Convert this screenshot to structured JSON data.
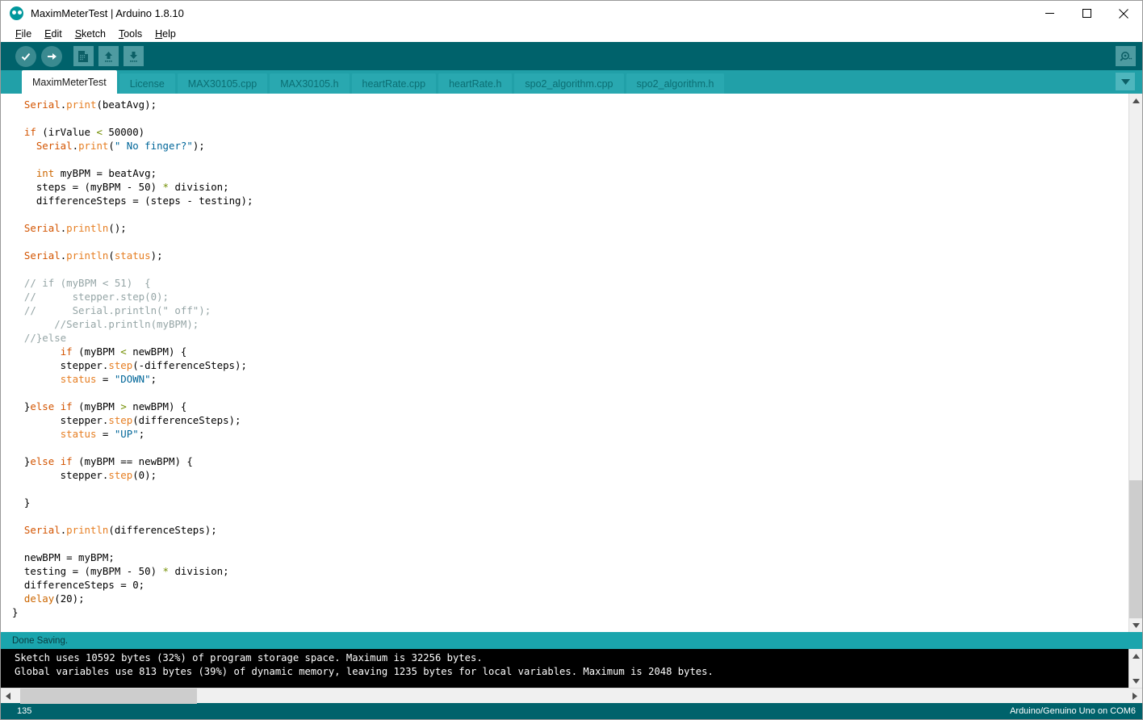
{
  "window": {
    "title": "MaximMeterTest | Arduino 1.8.10",
    "logo_icon": "arduino-logo-icon",
    "minimize_label": "Minimize",
    "maximize_label": "Maximize",
    "close_label": "Close"
  },
  "menubar": {
    "items": [
      {
        "label": "File",
        "mnemonic": "F"
      },
      {
        "label": "Edit",
        "mnemonic": "E"
      },
      {
        "label": "Sketch",
        "mnemonic": "S"
      },
      {
        "label": "Tools",
        "mnemonic": "T"
      },
      {
        "label": "Help",
        "mnemonic": "H"
      }
    ]
  },
  "toolbar": {
    "buttons": [
      {
        "name": "verify-button",
        "icon": "checkmark-icon",
        "tooltip": "Verify"
      },
      {
        "name": "upload-button",
        "icon": "arrow-right-icon",
        "tooltip": "Upload"
      },
      {
        "name": "new-button",
        "icon": "new-document-icon",
        "tooltip": "New"
      },
      {
        "name": "open-button",
        "icon": "arrow-up-icon",
        "tooltip": "Open"
      },
      {
        "name": "save-button",
        "icon": "arrow-down-icon",
        "tooltip": "Save"
      }
    ],
    "serial_monitor": {
      "icon": "magnifier-icon",
      "tooltip": "Serial Monitor"
    }
  },
  "tabs": {
    "items": [
      {
        "label": "MaximMeterTest",
        "active": true
      },
      {
        "label": "License",
        "active": false
      },
      {
        "label": "MAX30105.cpp",
        "active": false
      },
      {
        "label": "MAX30105.h",
        "active": false
      },
      {
        "label": "heartRate.cpp",
        "active": false
      },
      {
        "label": "heartRate.h",
        "active": false
      },
      {
        "label": "spo2_algorithm.cpp",
        "active": false
      },
      {
        "label": "spo2_algorithm.h",
        "active": false
      }
    ],
    "dropdown_icon": "chevron-down-icon"
  },
  "editor": {
    "lines": [
      [
        {
          "t": "  ",
          "c": ""
        },
        {
          "t": "Serial",
          "c": "kw1"
        },
        {
          "t": ".",
          "c": ""
        },
        {
          "t": "print",
          "c": "kw2"
        },
        {
          "t": "(beatAvg);",
          "c": ""
        }
      ],
      [],
      [
        {
          "t": "  ",
          "c": ""
        },
        {
          "t": "if",
          "c": "kw1"
        },
        {
          "t": " (irValue ",
          "c": ""
        },
        {
          "t": "<",
          "c": "op"
        },
        {
          "t": " 50000)",
          "c": ""
        }
      ],
      [
        {
          "t": "    ",
          "c": ""
        },
        {
          "t": "Serial",
          "c": "kw1"
        },
        {
          "t": ".",
          "c": ""
        },
        {
          "t": "print",
          "c": "kw2"
        },
        {
          "t": "(",
          "c": ""
        },
        {
          "t": "\" No finger?\"",
          "c": "str"
        },
        {
          "t": ");",
          "c": ""
        }
      ],
      [],
      [
        {
          "t": "    ",
          "c": ""
        },
        {
          "t": "int",
          "c": "kw3"
        },
        {
          "t": " myBPM = beatAvg;",
          "c": ""
        }
      ],
      [
        {
          "t": "    steps = (myBPM ",
          "c": ""
        },
        {
          "t": "-",
          "c": ""
        },
        {
          "t": " 50) ",
          "c": ""
        },
        {
          "t": "*",
          "c": "op"
        },
        {
          "t": " division;",
          "c": ""
        }
      ],
      [
        {
          "t": "    differenceSteps = (steps ",
          "c": ""
        },
        {
          "t": "-",
          "c": ""
        },
        {
          "t": " testing);",
          "c": ""
        }
      ],
      [],
      [
        {
          "t": "  ",
          "c": ""
        },
        {
          "t": "Serial",
          "c": "kw1"
        },
        {
          "t": ".",
          "c": ""
        },
        {
          "t": "println",
          "c": "kw2"
        },
        {
          "t": "();",
          "c": ""
        }
      ],
      [],
      [
        {
          "t": "  ",
          "c": ""
        },
        {
          "t": "Serial",
          "c": "kw1"
        },
        {
          "t": ".",
          "c": ""
        },
        {
          "t": "println",
          "c": "kw2"
        },
        {
          "t": "(",
          "c": ""
        },
        {
          "t": "status",
          "c": "kw2"
        },
        {
          "t": ");",
          "c": ""
        }
      ],
      [],
      [
        {
          "t": "  // if (myBPM < 51)  {",
          "c": "cmt"
        }
      ],
      [
        {
          "t": "  //      stepper.step(0);",
          "c": "cmt"
        }
      ],
      [
        {
          "t": "  //      Serial.println(\" off\");",
          "c": "cmt"
        }
      ],
      [
        {
          "t": "       //Serial.println(myBPM);",
          "c": "cmt"
        }
      ],
      [
        {
          "t": "  //}else",
          "c": "cmt"
        }
      ],
      [
        {
          "t": "        ",
          "c": ""
        },
        {
          "t": "if",
          "c": "kw1"
        },
        {
          "t": " (myBPM ",
          "c": ""
        },
        {
          "t": "<",
          "c": "op"
        },
        {
          "t": " newBPM) {",
          "c": ""
        }
      ],
      [
        {
          "t": "        stepper.",
          "c": ""
        },
        {
          "t": "step",
          "c": "kw2"
        },
        {
          "t": "(-differenceSteps);",
          "c": ""
        }
      ],
      [
        {
          "t": "        ",
          "c": ""
        },
        {
          "t": "status",
          "c": "kw2"
        },
        {
          "t": " = ",
          "c": ""
        },
        {
          "t": "\"DOWN\"",
          "c": "str"
        },
        {
          "t": ";",
          "c": ""
        }
      ],
      [],
      [
        {
          "t": "  }",
          "c": ""
        },
        {
          "t": "else",
          "c": "kw1"
        },
        {
          "t": " ",
          "c": ""
        },
        {
          "t": "if",
          "c": "kw1"
        },
        {
          "t": " (myBPM ",
          "c": ""
        },
        {
          "t": ">",
          "c": "op"
        },
        {
          "t": " newBPM) {",
          "c": ""
        }
      ],
      [
        {
          "t": "        stepper.",
          "c": ""
        },
        {
          "t": "step",
          "c": "kw2"
        },
        {
          "t": "(differenceSteps);",
          "c": ""
        }
      ],
      [
        {
          "t": "        ",
          "c": ""
        },
        {
          "t": "status",
          "c": "kw2"
        },
        {
          "t": " = ",
          "c": ""
        },
        {
          "t": "\"UP\"",
          "c": "str"
        },
        {
          "t": ";",
          "c": ""
        }
      ],
      [],
      [
        {
          "t": "  }",
          "c": ""
        },
        {
          "t": "else",
          "c": "kw1"
        },
        {
          "t": " ",
          "c": ""
        },
        {
          "t": "if",
          "c": "kw1"
        },
        {
          "t": " (myBPM == newBPM) {",
          "c": ""
        }
      ],
      [
        {
          "t": "        stepper.",
          "c": ""
        },
        {
          "t": "step",
          "c": "kw2"
        },
        {
          "t": "(0);",
          "c": ""
        }
      ],
      [],
      [
        {
          "t": "  }",
          "c": ""
        }
      ],
      [],
      [
        {
          "t": "  ",
          "c": ""
        },
        {
          "t": "Serial",
          "c": "kw1"
        },
        {
          "t": ".",
          "c": ""
        },
        {
          "t": "println",
          "c": "kw2"
        },
        {
          "t": "(differenceSteps);",
          "c": ""
        }
      ],
      [],
      [
        {
          "t": "  newBPM = myBPM;",
          "c": ""
        }
      ],
      [
        {
          "t": "  testing = (myBPM ",
          "c": ""
        },
        {
          "t": "-",
          "c": ""
        },
        {
          "t": " 50) ",
          "c": ""
        },
        {
          "t": "*",
          "c": "op"
        },
        {
          "t": " division;",
          "c": ""
        }
      ],
      [
        {
          "t": "  differenceSteps = 0;",
          "c": ""
        }
      ],
      [
        {
          "t": "  ",
          "c": ""
        },
        {
          "t": "delay",
          "c": "kw3"
        },
        {
          "t": "(20);",
          "c": ""
        }
      ],
      [
        {
          "t": "}",
          "c": ""
        }
      ]
    ],
    "scroll_up_icon": "chevron-up-icon",
    "scroll_down_icon": "chevron-down-icon"
  },
  "status_message": "Done Saving.",
  "console": {
    "lines": [
      "Sketch uses 10592 bytes (32%) of program storage space. Maximum is 32256 bytes.",
      "Global variables use 813 bytes (39%) of dynamic memory, leaving 1235 bytes for local variables. Maximum is 2048 bytes."
    ],
    "scroll_up_icon": "chevron-up-icon",
    "scroll_down_icon": "chevron-down-icon",
    "scroll_left_icon": "chevron-left-icon",
    "scroll_right_icon": "chevron-right-icon"
  },
  "statusbar": {
    "line_number": "135",
    "board_info": "Arduino/Genuino Uno on COM6"
  }
}
